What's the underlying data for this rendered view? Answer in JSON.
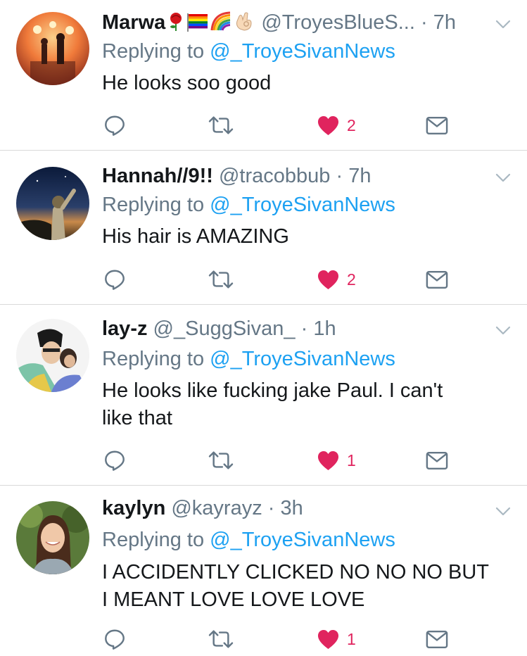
{
  "colors": {
    "accent": "#1da1f2",
    "like": "#e0245e",
    "muted": "#657786",
    "text": "#14171a"
  },
  "tweets": [
    {
      "name": "Marwa",
      "handle": "@TroyesBlueS...",
      "dot": "·",
      "time": "7h",
      "reply_prefix": "Replying to",
      "reply_to": "@_TroyeSivanNews",
      "text": "He looks soo good",
      "likes": "2",
      "emojis": [
        "rose-emoji",
        "rainbow-flag-emoji",
        "rainbow-emoji",
        "ok-hand-emoji"
      ]
    },
    {
      "name": "Hannah//9!!",
      "handle": "@tracobbub",
      "dot": "·",
      "time": "7h",
      "reply_prefix": "Replying to",
      "reply_to": "@_TroyeSivanNews",
      "text": "His hair is AMAZING",
      "likes": "2"
    },
    {
      "name": "lay-z",
      "handle": "@_SuggSivan_",
      "dot": "·",
      "time": "1h",
      "reply_prefix": "Replying to",
      "reply_to": "@_TroyeSivanNews",
      "text_line1": "He looks like fucking jake Paul. I can't",
      "text_line2": "like that",
      "likes": "1"
    },
    {
      "name": "kaylyn",
      "handle": "@kayrayz",
      "dot": "·",
      "time": "3h",
      "reply_prefix": "Replying to",
      "reply_to": "@_TroyeSivanNews",
      "text_line1": "I ACCIDENTLY CLICKED NO NO NO BUT",
      "text_line2": "I MEANT LOVE LOVE LOVE",
      "likes": "1"
    }
  ],
  "icons": [
    "reply-icon",
    "retweet-icon",
    "heart-icon",
    "dm-icon",
    "chevron-down-icon"
  ]
}
